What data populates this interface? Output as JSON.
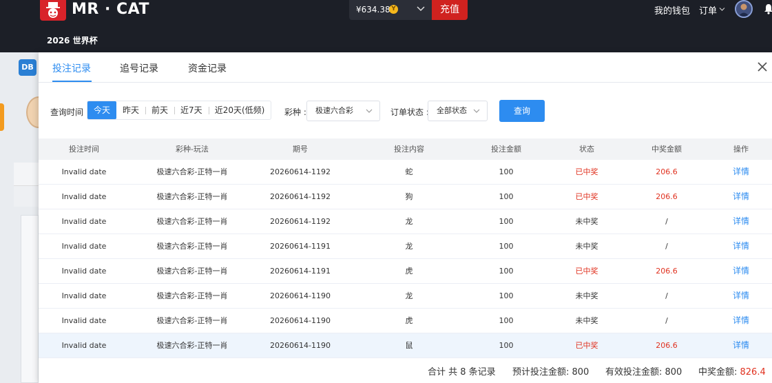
{
  "header": {
    "brand": "MR · CAT",
    "world_cup_link": "2026 世界杯",
    "balance": "¥634.38",
    "coin_symbol": "Y",
    "recharge_label": "充值",
    "wallet_link": "我的钱包",
    "orders_link": "订单"
  },
  "background": {
    "app_badge": "DB"
  },
  "modal": {
    "tabs": [
      {
        "label": "投注记录",
        "active": true
      },
      {
        "label": "追号记录",
        "active": false
      },
      {
        "label": "资金记录",
        "active": false
      }
    ],
    "filters": {
      "time_label": "查询时间 :",
      "time_options": [
        "今天",
        "昨天",
        "前天",
        "近7天",
        "近20天(低频)"
      ],
      "time_selected": "今天",
      "lottery_label": "彩种 :",
      "lottery_value": "极速六合彩",
      "status_label": "订单状态 :",
      "status_value": "全部状态",
      "query_label": "查询"
    },
    "table": {
      "headers": [
        "投注时间",
        "彩种-玩法",
        "期号",
        "投注内容",
        "投注金额",
        "状态",
        "中奖金额",
        "操作"
      ],
      "rows": [
        {
          "time": "Invalid date",
          "game": "极速六合彩-正特一肖",
          "issue": "20260614-1192",
          "content": "蛇",
          "amount": "100",
          "status": "已中奖",
          "won": true,
          "prize": "206.6",
          "action": "详情"
        },
        {
          "time": "Invalid date",
          "game": "极速六合彩-正特一肖",
          "issue": "20260614-1192",
          "content": "狗",
          "amount": "100",
          "status": "已中奖",
          "won": true,
          "prize": "206.6",
          "action": "详情"
        },
        {
          "time": "Invalid date",
          "game": "极速六合彩-正特一肖",
          "issue": "20260614-1192",
          "content": "龙",
          "amount": "100",
          "status": "未中奖",
          "won": false,
          "prize": "/",
          "action": "详情"
        },
        {
          "time": "Invalid date",
          "game": "极速六合彩-正特一肖",
          "issue": "20260614-1191",
          "content": "龙",
          "amount": "100",
          "status": "未中奖",
          "won": false,
          "prize": "/",
          "action": "详情"
        },
        {
          "time": "Invalid date",
          "game": "极速六合彩-正特一肖",
          "issue": "20260614-1191",
          "content": "虎",
          "amount": "100",
          "status": "已中奖",
          "won": true,
          "prize": "206.6",
          "action": "详情"
        },
        {
          "time": "Invalid date",
          "game": "极速六合彩-正特一肖",
          "issue": "20260614-1190",
          "content": "龙",
          "amount": "100",
          "status": "未中奖",
          "won": false,
          "prize": "/",
          "action": "详情"
        },
        {
          "time": "Invalid date",
          "game": "极速六合彩-正特一肖",
          "issue": "20260614-1190",
          "content": "虎",
          "amount": "100",
          "status": "未中奖",
          "won": false,
          "prize": "/",
          "action": "详情"
        },
        {
          "time": "Invalid date",
          "game": "极速六合彩-正特一肖",
          "issue": "20260614-1190",
          "content": "鼠",
          "amount": "100",
          "status": "已中奖",
          "won": true,
          "prize": "206.6",
          "action": "详情",
          "highlighted": true
        }
      ]
    },
    "summary": {
      "total": "合计 共 8 条记录",
      "expected_label": "预计投注金额: 800",
      "valid_label": "有效投注金额: 800",
      "prize_label": "中奖金额: ",
      "prize_value": "826.4"
    }
  },
  "colors": {
    "accent": "#2d8cf0",
    "won": "#e0301e",
    "brand_red": "#d0221f"
  }
}
